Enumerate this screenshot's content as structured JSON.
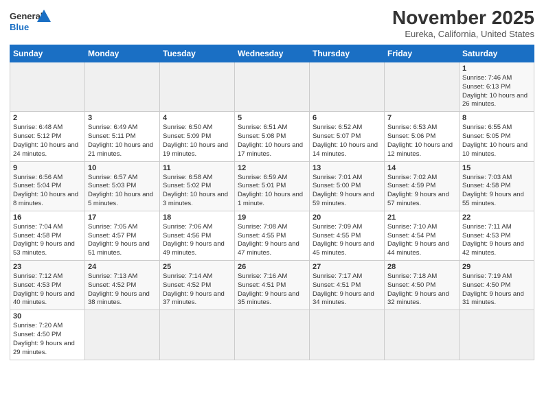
{
  "header": {
    "logo_general": "General",
    "logo_blue": "Blue",
    "month_title": "November 2025",
    "location": "Eureka, California, United States"
  },
  "days_of_week": [
    "Sunday",
    "Monday",
    "Tuesday",
    "Wednesday",
    "Thursday",
    "Friday",
    "Saturday"
  ],
  "weeks": [
    [
      {
        "day": "",
        "info": ""
      },
      {
        "day": "",
        "info": ""
      },
      {
        "day": "",
        "info": ""
      },
      {
        "day": "",
        "info": ""
      },
      {
        "day": "",
        "info": ""
      },
      {
        "day": "",
        "info": ""
      },
      {
        "day": "1",
        "info": "Sunrise: 7:46 AM\nSunset: 6:13 PM\nDaylight: 10 hours and 26 minutes."
      }
    ],
    [
      {
        "day": "2",
        "info": "Sunrise: 6:48 AM\nSunset: 5:12 PM\nDaylight: 10 hours and 24 minutes."
      },
      {
        "day": "3",
        "info": "Sunrise: 6:49 AM\nSunset: 5:11 PM\nDaylight: 10 hours and 21 minutes."
      },
      {
        "day": "4",
        "info": "Sunrise: 6:50 AM\nSunset: 5:09 PM\nDaylight: 10 hours and 19 minutes."
      },
      {
        "day": "5",
        "info": "Sunrise: 6:51 AM\nSunset: 5:08 PM\nDaylight: 10 hours and 17 minutes."
      },
      {
        "day": "6",
        "info": "Sunrise: 6:52 AM\nSunset: 5:07 PM\nDaylight: 10 hours and 14 minutes."
      },
      {
        "day": "7",
        "info": "Sunrise: 6:53 AM\nSunset: 5:06 PM\nDaylight: 10 hours and 12 minutes."
      },
      {
        "day": "8",
        "info": "Sunrise: 6:55 AM\nSunset: 5:05 PM\nDaylight: 10 hours and 10 minutes."
      }
    ],
    [
      {
        "day": "9",
        "info": "Sunrise: 6:56 AM\nSunset: 5:04 PM\nDaylight: 10 hours and 8 minutes."
      },
      {
        "day": "10",
        "info": "Sunrise: 6:57 AM\nSunset: 5:03 PM\nDaylight: 10 hours and 5 minutes."
      },
      {
        "day": "11",
        "info": "Sunrise: 6:58 AM\nSunset: 5:02 PM\nDaylight: 10 hours and 3 minutes."
      },
      {
        "day": "12",
        "info": "Sunrise: 6:59 AM\nSunset: 5:01 PM\nDaylight: 10 hours and 1 minute."
      },
      {
        "day": "13",
        "info": "Sunrise: 7:01 AM\nSunset: 5:00 PM\nDaylight: 9 hours and 59 minutes."
      },
      {
        "day": "14",
        "info": "Sunrise: 7:02 AM\nSunset: 4:59 PM\nDaylight: 9 hours and 57 minutes."
      },
      {
        "day": "15",
        "info": "Sunrise: 7:03 AM\nSunset: 4:58 PM\nDaylight: 9 hours and 55 minutes."
      }
    ],
    [
      {
        "day": "16",
        "info": "Sunrise: 7:04 AM\nSunset: 4:58 PM\nDaylight: 9 hours and 53 minutes."
      },
      {
        "day": "17",
        "info": "Sunrise: 7:05 AM\nSunset: 4:57 PM\nDaylight: 9 hours and 51 minutes."
      },
      {
        "day": "18",
        "info": "Sunrise: 7:06 AM\nSunset: 4:56 PM\nDaylight: 9 hours and 49 minutes."
      },
      {
        "day": "19",
        "info": "Sunrise: 7:08 AM\nSunset: 4:55 PM\nDaylight: 9 hours and 47 minutes."
      },
      {
        "day": "20",
        "info": "Sunrise: 7:09 AM\nSunset: 4:55 PM\nDaylight: 9 hours and 45 minutes."
      },
      {
        "day": "21",
        "info": "Sunrise: 7:10 AM\nSunset: 4:54 PM\nDaylight: 9 hours and 44 minutes."
      },
      {
        "day": "22",
        "info": "Sunrise: 7:11 AM\nSunset: 4:53 PM\nDaylight: 9 hours and 42 minutes."
      }
    ],
    [
      {
        "day": "23",
        "info": "Sunrise: 7:12 AM\nSunset: 4:53 PM\nDaylight: 9 hours and 40 minutes."
      },
      {
        "day": "24",
        "info": "Sunrise: 7:13 AM\nSunset: 4:52 PM\nDaylight: 9 hours and 38 minutes."
      },
      {
        "day": "25",
        "info": "Sunrise: 7:14 AM\nSunset: 4:52 PM\nDaylight: 9 hours and 37 minutes."
      },
      {
        "day": "26",
        "info": "Sunrise: 7:16 AM\nSunset: 4:51 PM\nDaylight: 9 hours and 35 minutes."
      },
      {
        "day": "27",
        "info": "Sunrise: 7:17 AM\nSunset: 4:51 PM\nDaylight: 9 hours and 34 minutes."
      },
      {
        "day": "28",
        "info": "Sunrise: 7:18 AM\nSunset: 4:50 PM\nDaylight: 9 hours and 32 minutes."
      },
      {
        "day": "29",
        "info": "Sunrise: 7:19 AM\nSunset: 4:50 PM\nDaylight: 9 hours and 31 minutes."
      }
    ],
    [
      {
        "day": "30",
        "info": "Sunrise: 7:20 AM\nSunset: 4:50 PM\nDaylight: 9 hours and 29 minutes."
      },
      {
        "day": "",
        "info": ""
      },
      {
        "day": "",
        "info": ""
      },
      {
        "day": "",
        "info": ""
      },
      {
        "day": "",
        "info": ""
      },
      {
        "day": "",
        "info": ""
      },
      {
        "day": "",
        "info": ""
      }
    ]
  ]
}
